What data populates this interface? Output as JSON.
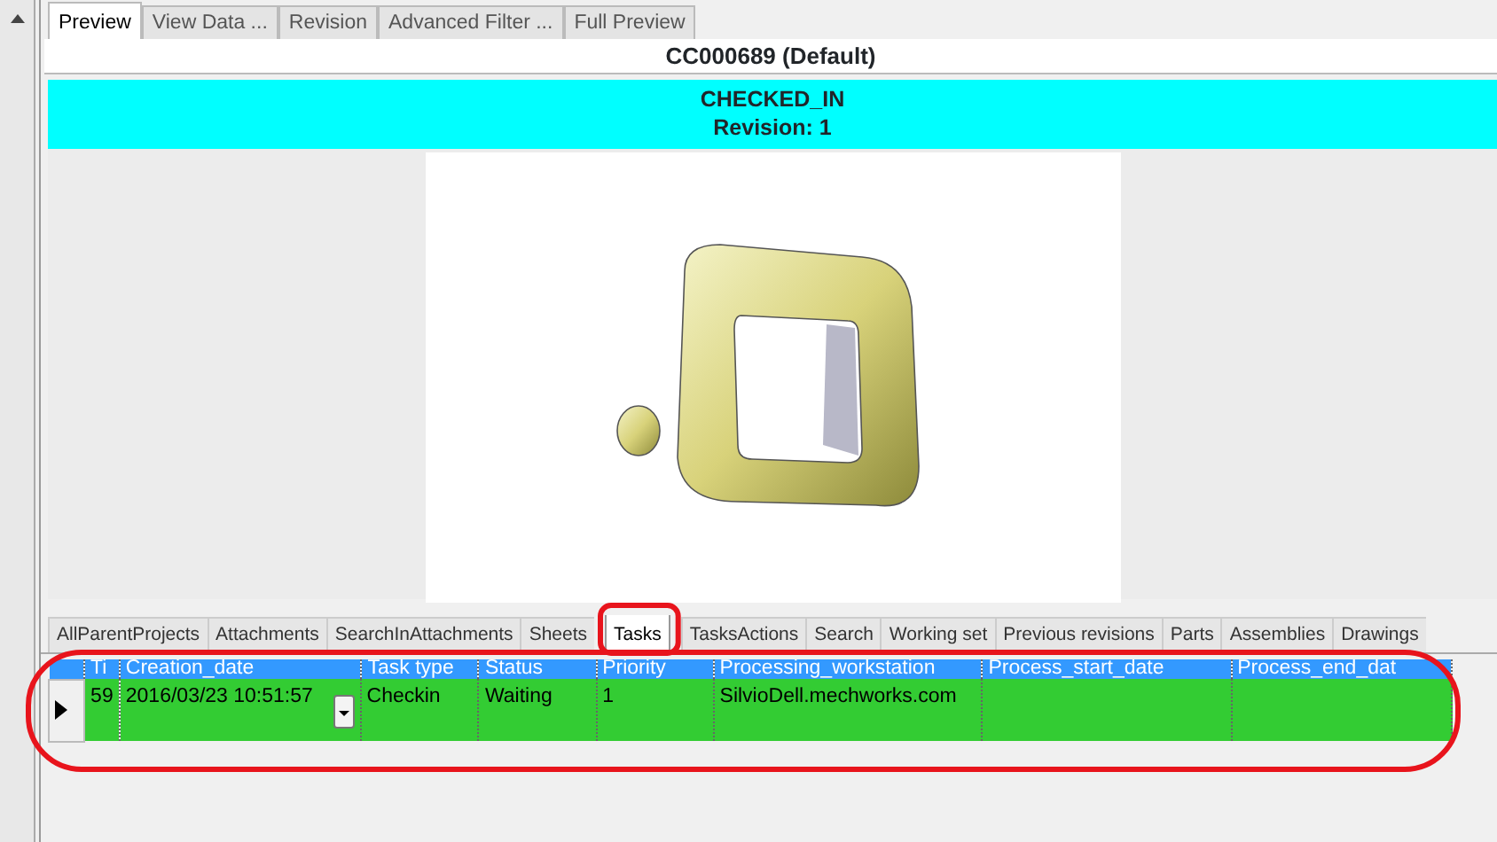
{
  "top_tabs": [
    {
      "label": "Preview",
      "selected": true
    },
    {
      "label": "View Data ...",
      "selected": false
    },
    {
      "label": "Revision",
      "selected": false
    },
    {
      "label": "Advanced Filter ...",
      "selected": false
    },
    {
      "label": "Full Preview",
      "selected": false
    }
  ],
  "document": {
    "title": "CC000689 (Default)",
    "state": "CHECKED_IN",
    "revision": "Revision: 1"
  },
  "bottom_tabs": [
    {
      "label": "AllParentProjects",
      "selected": false
    },
    {
      "label": "Attachments",
      "selected": false
    },
    {
      "label": "SearchInAttachments",
      "selected": false
    },
    {
      "label": "Sheets",
      "selected": false
    },
    {
      "label": "Tasks",
      "selected": true
    },
    {
      "label": "TasksActions",
      "selected": false
    },
    {
      "label": "Search",
      "selected": false
    },
    {
      "label": "Working set",
      "selected": false
    },
    {
      "label": "Previous revisions",
      "selected": false
    },
    {
      "label": "Parts",
      "selected": false
    },
    {
      "label": "Assemblies",
      "selected": false
    },
    {
      "label": "Drawings",
      "selected": false
    }
  ],
  "table": {
    "columns": [
      "Ti",
      "Creation_date",
      "Task type",
      "Status",
      "Priority",
      "Processing_workstation",
      "Process_start_date",
      "Process_end_dat"
    ],
    "rows": [
      {
        "selected": true,
        "cells": [
          "59",
          "2016/03/23 10:51:57",
          "Checkin",
          "Waiting",
          "1",
          "SilvioDell.mechworks.com",
          "",
          ""
        ]
      }
    ]
  }
}
